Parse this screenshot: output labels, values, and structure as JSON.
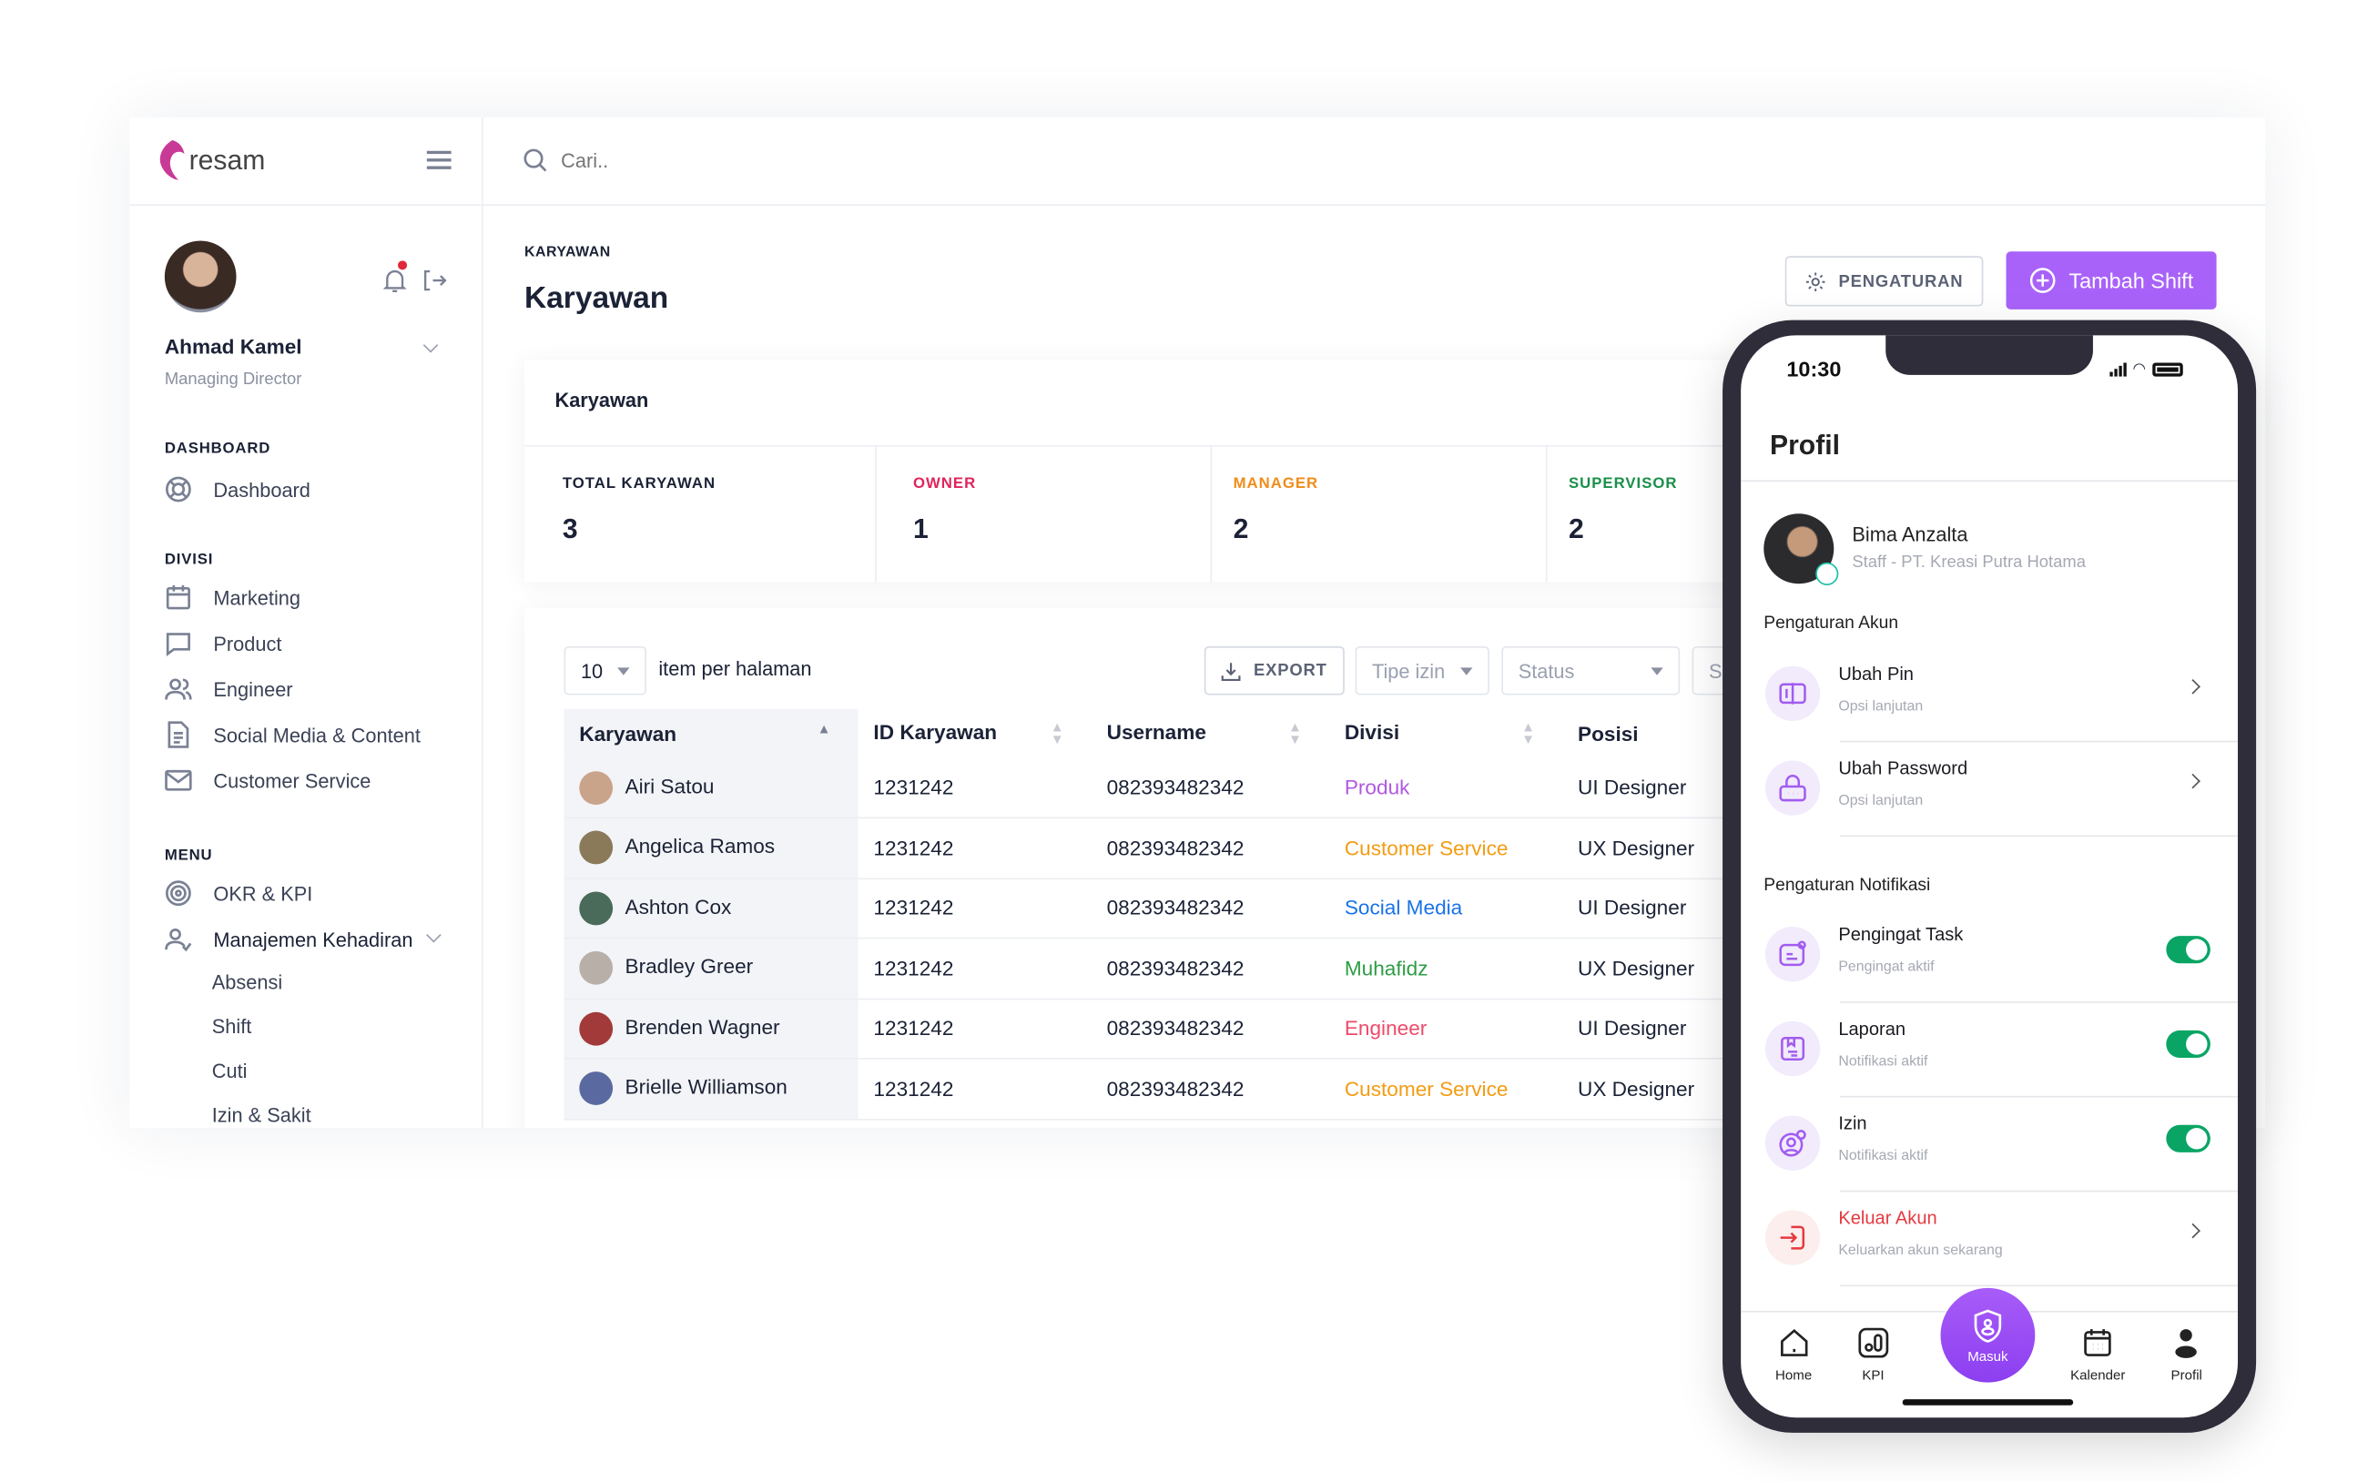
{
  "brand": {
    "name": "resam",
    "logo_colors": [
      "#e0307a",
      "#8e44c8"
    ]
  },
  "search": {
    "placeholder": "Cari.."
  },
  "user": {
    "name": "Ahmad Kamel",
    "role": "Managing Director"
  },
  "sidebar": {
    "dashboard_section": "DASHBOARD",
    "dashboard_items": [
      {
        "label": "Dashboard",
        "icon": "lifebuoy-icon"
      }
    ],
    "divisi_section": "DIVISI",
    "divisi_items": [
      {
        "label": "Marketing",
        "icon": "calendar-icon"
      },
      {
        "label": "Product",
        "icon": "chat-icon"
      },
      {
        "label": "Engineer",
        "icon": "users-icon"
      },
      {
        "label": "Social Media & Content",
        "icon": "document-icon"
      },
      {
        "label": "Customer Service",
        "icon": "mail-icon"
      }
    ],
    "menu_section": "MENU",
    "menu_items": [
      {
        "label": "OKR & KPI",
        "icon": "target-icon"
      },
      {
        "label": "Manajemen Kehadiran",
        "icon": "user-check-icon"
      }
    ],
    "submenu": [
      "Absensi",
      "Shift",
      "Cuti",
      "Izin & Sakit"
    ]
  },
  "page": {
    "breadcrumb": "KARYAWAN",
    "title": "Karyawan",
    "settings_button": "PENGATURAN",
    "add_button": "Tambah Shift",
    "accent": "#a862f9"
  },
  "stats": {
    "card_title": "Karyawan",
    "items": [
      {
        "label": "TOTAL KARYAWAN",
        "value": "3",
        "color": "#1b2236"
      },
      {
        "label": "OWNER",
        "value": "1",
        "color": "#e0245e"
      },
      {
        "label": "MANAGER",
        "value": "2",
        "color": "#f08c1a"
      },
      {
        "label": "SUPERVISOR",
        "value": "2",
        "color": "#1a8f4a"
      }
    ]
  },
  "table": {
    "page_size": "10",
    "page_size_label": "item per halaman",
    "export_label": "EXPORT",
    "filter_type_placeholder": "Tipe izin",
    "filter_status_placeholder": "Status",
    "search_partial": "Se",
    "columns": [
      "Karyawan",
      "ID Karyawan",
      "Username",
      "Divisi",
      "Posisi"
    ],
    "rows": [
      {
        "name": "Airi Satou",
        "id": "1231242",
        "username": "082393482342",
        "divisi": "Produk",
        "divisi_color": "#b058e0",
        "posisi": "UI Designer",
        "avatar": "#c9a48a"
      },
      {
        "name": "Angelica Ramos",
        "id": "1231242",
        "username": "082393482342",
        "divisi": "Customer Service",
        "divisi_color": "#f39c12",
        "posisi": "UX Designer",
        "avatar": "#8a7a5a"
      },
      {
        "name": "Ashton Cox",
        "id": "1231242",
        "username": "082393482342",
        "divisi": "Social Media",
        "divisi_color": "#1a73e8",
        "posisi": "UI Designer",
        "avatar": "#4a6a5a"
      },
      {
        "name": "Bradley Greer",
        "id": "1231242",
        "username": "082393482342",
        "divisi": "Muhafidz",
        "divisi_color": "#2e9d44",
        "posisi": "UX Designer",
        "avatar": "#b8b0a8"
      },
      {
        "name": "Brenden Wagner",
        "id": "1231242",
        "username": "082393482342",
        "divisi": "Engineer",
        "divisi_color": "#ef4a6a",
        "posisi": "UI Designer",
        "avatar": "#a23a3a"
      },
      {
        "name": "Brielle Williamson",
        "id": "1231242",
        "username": "082393482342",
        "divisi": "Customer Service",
        "divisi_color": "#f39c12",
        "posisi": "UX Designer",
        "avatar": "#5a6aa0"
      }
    ]
  },
  "phone": {
    "time": "10:30",
    "title": "Profil",
    "user": {
      "name": "Bima Anzalta",
      "subtitle": "Staff - PT. Kreasi Putra Hotama"
    },
    "account_section": "Pengaturan Akun",
    "account_items": [
      {
        "title": "Ubah Pin",
        "subtitle": "Opsi lanjutan",
        "icon": "pin-icon"
      },
      {
        "title": "Ubah Password",
        "subtitle": "Opsi lanjutan",
        "icon": "lock-icon"
      }
    ],
    "notif_section": "Pengaturan Notifikasi",
    "notif_items": [
      {
        "title": "Pengingat Task",
        "subtitle": "Pengingat aktif",
        "icon": "task-icon",
        "on": true
      },
      {
        "title": "Laporan",
        "subtitle": "Notifikasi aktif",
        "icon": "report-icon",
        "on": true
      },
      {
        "title": "Izin",
        "subtitle": "Notifikasi aktif",
        "icon": "user-plus-icon",
        "on": true
      }
    ],
    "logout": {
      "title": "Keluar Akun",
      "subtitle": "Keluarkan akun sekarang",
      "color": "#e5393f"
    },
    "tabs": [
      {
        "label": "Home",
        "icon": "home-icon"
      },
      {
        "label": "KPI",
        "icon": "chart-icon"
      },
      {
        "label": "Masuk",
        "icon": "shield-user-icon"
      },
      {
        "label": "Kalender",
        "icon": "calendar-icon"
      },
      {
        "label": "Profil",
        "icon": "person-icon"
      }
    ]
  }
}
